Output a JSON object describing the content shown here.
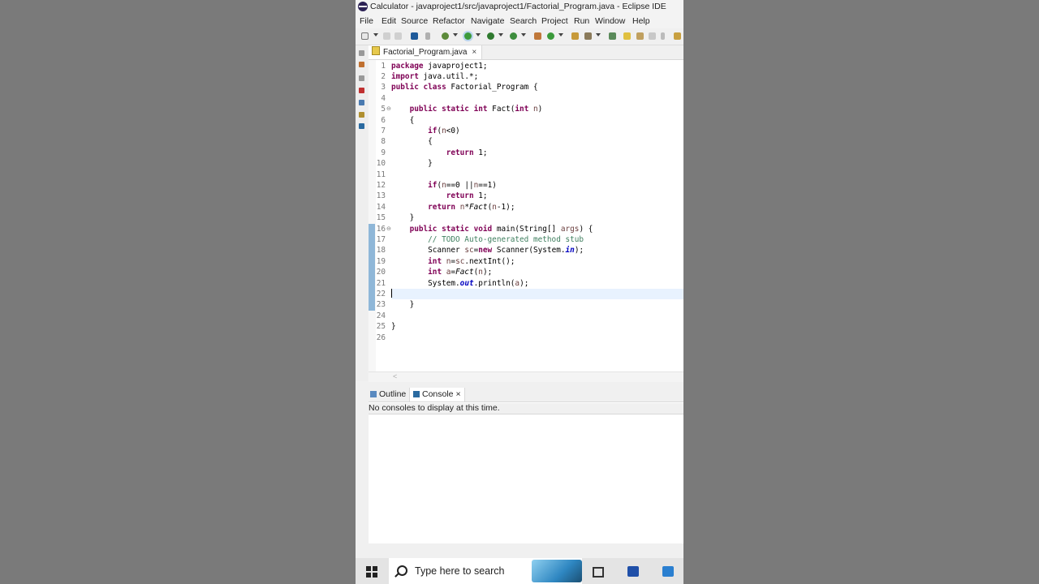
{
  "window": {
    "title": "Calculator - javaproject1/src/javaproject1/Factorial_Program.java - Eclipse IDE"
  },
  "menu": [
    "File",
    "Edit",
    "Source",
    "Refactor",
    "Navigate",
    "Search",
    "Project",
    "Run",
    "Window",
    "Help"
  ],
  "editor": {
    "tab_label": "Factorial_Program.java",
    "close_glyph": "×",
    "current_line": 22,
    "lines": [
      [
        {
          "t": "package",
          "c": "kw"
        },
        {
          "t": " javaproject1;"
        }
      ],
      [
        {
          "t": "import",
          "c": "kw"
        },
        {
          "t": " java.util.*;"
        }
      ],
      [
        {
          "t": "public class",
          "c": "kw"
        },
        {
          "t": " Factorial_Program {"
        }
      ],
      [],
      [
        {
          "t": "    "
        },
        {
          "t": "public static int",
          "c": "kw"
        },
        {
          "t": " Fact("
        },
        {
          "t": "int",
          "c": "kw"
        },
        {
          "t": " "
        },
        {
          "t": "n",
          "c": "vr"
        },
        {
          "t": ")"
        }
      ],
      [
        {
          "t": "    {"
        }
      ],
      [
        {
          "t": "        "
        },
        {
          "t": "if",
          "c": "kw"
        },
        {
          "t": "("
        },
        {
          "t": "n",
          "c": "vr"
        },
        {
          "t": "<0)"
        }
      ],
      [
        {
          "t": "        {"
        }
      ],
      [
        {
          "t": "            "
        },
        {
          "t": "return",
          "c": "kw"
        },
        {
          "t": " 1;"
        }
      ],
      [
        {
          "t": "        }"
        }
      ],
      [],
      [
        {
          "t": "        "
        },
        {
          "t": "if",
          "c": "kw"
        },
        {
          "t": "("
        },
        {
          "t": "n",
          "c": "vr"
        },
        {
          "t": "==0 ||"
        },
        {
          "t": "n",
          "c": "vr"
        },
        {
          "t": "==1)"
        }
      ],
      [
        {
          "t": "            "
        },
        {
          "t": "return",
          "c": "kw"
        },
        {
          "t": " 1;"
        }
      ],
      [
        {
          "t": "        "
        },
        {
          "t": "return",
          "c": "kw"
        },
        {
          "t": " "
        },
        {
          "t": "n",
          "c": "vr"
        },
        {
          "t": "*"
        },
        {
          "t": "Fact",
          "c": "st"
        },
        {
          "t": "("
        },
        {
          "t": "n",
          "c": "vr"
        },
        {
          "t": "-1);"
        }
      ],
      [
        {
          "t": "    }"
        }
      ],
      [
        {
          "t": "    "
        },
        {
          "t": "public static void",
          "c": "kw"
        },
        {
          "t": " main(String[] "
        },
        {
          "t": "args",
          "c": "vr"
        },
        {
          "t": ") {"
        }
      ],
      [
        {
          "t": "        "
        },
        {
          "t": "// TODO Auto-generated method stub",
          "c": "cm"
        }
      ],
      [
        {
          "t": "        Scanner "
        },
        {
          "t": "sc",
          "c": "vr"
        },
        {
          "t": "="
        },
        {
          "t": "new",
          "c": "kw"
        },
        {
          "t": " Scanner(System."
        },
        {
          "t": "in",
          "c": "fd"
        },
        {
          "t": ");"
        }
      ],
      [
        {
          "t": "        "
        },
        {
          "t": "int",
          "c": "kw"
        },
        {
          "t": " "
        },
        {
          "t": "n",
          "c": "vr"
        },
        {
          "t": "="
        },
        {
          "t": "sc",
          "c": "vr"
        },
        {
          "t": ".nextInt();"
        }
      ],
      [
        {
          "t": "        "
        },
        {
          "t": "int",
          "c": "kw"
        },
        {
          "t": " "
        },
        {
          "t": "a",
          "c": "vr"
        },
        {
          "t": "="
        },
        {
          "t": "Fact",
          "c": "st"
        },
        {
          "t": "("
        },
        {
          "t": "n",
          "c": "vr"
        },
        {
          "t": ");"
        }
      ],
      [
        {
          "t": "        System."
        },
        {
          "t": "out",
          "c": "fd"
        },
        {
          "t": ".println("
        },
        {
          "t": "a",
          "c": "vr"
        },
        {
          "t": ");"
        }
      ],
      [],
      [
        {
          "t": "    }"
        }
      ],
      [],
      [
        {
          "t": "}"
        }
      ],
      []
    ],
    "fold_lines": [
      5,
      16
    ]
  },
  "bottom_panel": {
    "outline_tab": "Outline",
    "console_tab": "Console",
    "close_glyph": "×",
    "message": "No consoles to display at this time."
  },
  "taskbar": {
    "search_placeholder": "Type here to search"
  },
  "colors": {
    "keyword": "#7f0055",
    "comment": "#3f7f5f",
    "field": "#0000c0",
    "local_var": "#6a3e3e",
    "current_line": "#e8f2fe",
    "change_marker": "#8fb7d8"
  },
  "icons": [
    "eclipse-logo-icon",
    "new-file-icon",
    "save-icon",
    "debug-icon",
    "run-icon",
    "coverage-icon",
    "search-icon",
    "windows-start-icon",
    "task-view-icon",
    "word-icon",
    "app-icon"
  ]
}
